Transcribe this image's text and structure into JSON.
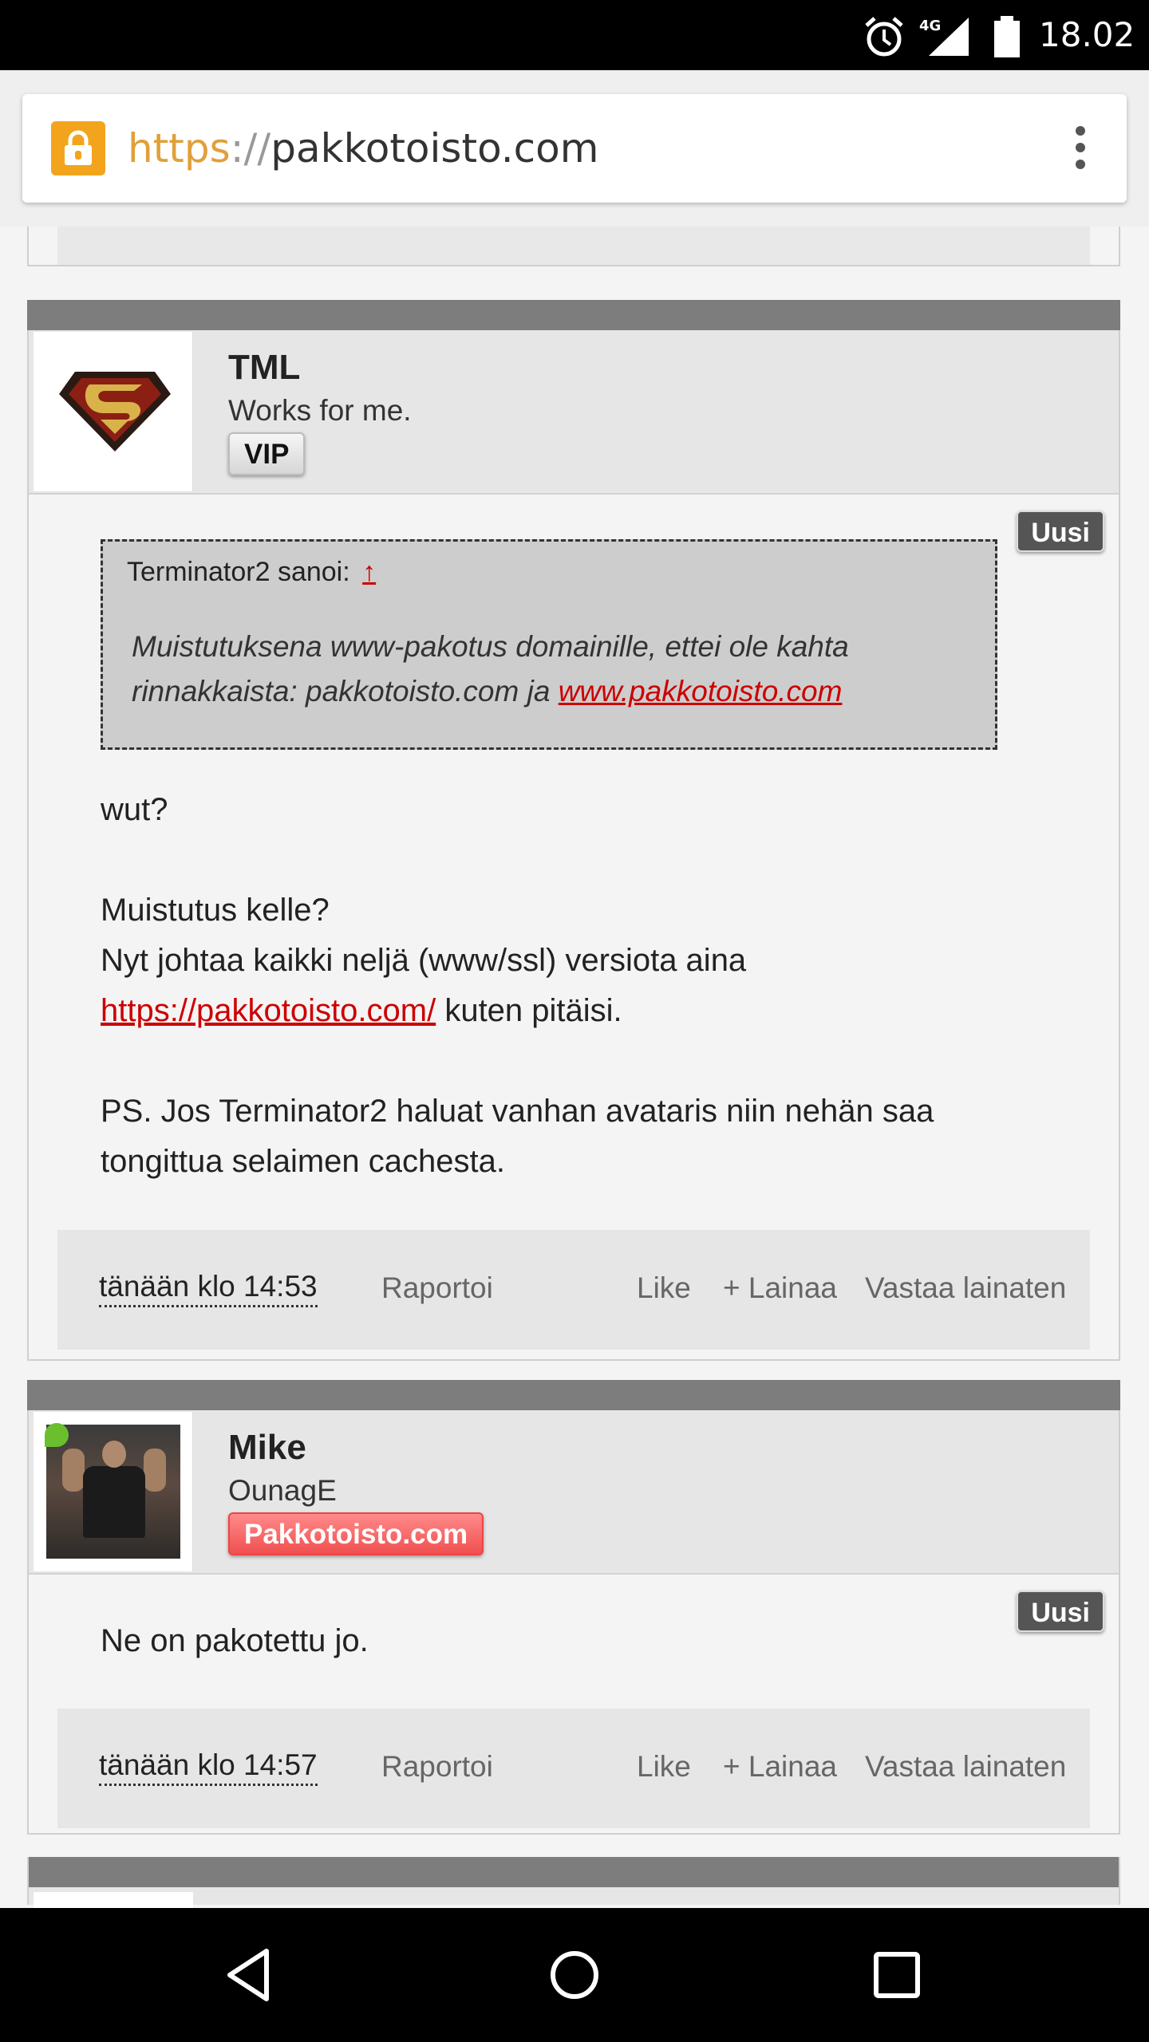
{
  "status_bar": {
    "time": "18.02",
    "network": "4G",
    "icons": [
      "alarm-icon",
      "signal-icon",
      "battery-icon"
    ]
  },
  "browser": {
    "url_scheme": "https",
    "url_separator": "://",
    "url_host": "pakkotoisto.com",
    "lock_color": "#f2a51c"
  },
  "posts": [
    {
      "author": "TML",
      "title": "Works for me.",
      "role": "VIP",
      "new_label": "Uusi",
      "quote": {
        "header": "Terminator2 sanoi:",
        "arrow": "↑",
        "text_line1": "Muistutuksena www-pakotus domainille, ettei ole kahta",
        "text_line2_prefix": "rinnakkaista: pakkotoisto.com ja ",
        "link": "www.pakkotoisto.com"
      },
      "message": {
        "p1": "wut?",
        "p2_line1": "Muistutus kelle?",
        "p2_line2": "Nyt johtaa kaikki neljä (www/ssl) versiota aina",
        "p2_link": "https://pakkotoisto.com/",
        "p2_suffix": " kuten pitäisi.",
        "p3_line1": "PS. Jos Terminator2 haluat vanhan avataris niin nehän saa",
        "p3_line2": "tongittua selaimen cachesta."
      },
      "footer": {
        "time": "tänään klo 14:53",
        "report": "Raportoi",
        "like": "Like",
        "quote": "+ Lainaa",
        "reply": "Vastaa lainaten"
      }
    },
    {
      "author": "Mike",
      "title": "OunagE",
      "role": "Pakkotoisto.com",
      "new_label": "Uusi",
      "message": {
        "p1": "Ne on pakotettu jo."
      },
      "footer": {
        "time": "tänään klo 14:57",
        "report": "Raportoi",
        "like": "Like",
        "quote": "+ Lainaa",
        "reply": "Vastaa lainaten"
      }
    }
  ],
  "colors": {
    "link": "#cc0000",
    "post_bar": "#7d7d7d",
    "online": "#6bbf2f"
  },
  "nav": {
    "icons": [
      "back-icon",
      "home-icon",
      "recent-apps-icon"
    ]
  }
}
